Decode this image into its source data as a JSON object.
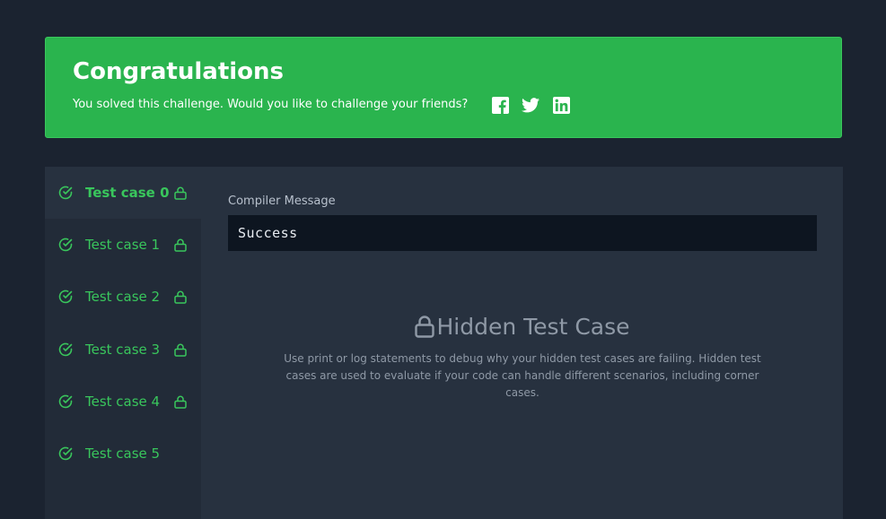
{
  "banner": {
    "title": "Congratulations",
    "message": "You solved this challenge. Would you like to challenge your friends?",
    "social": [
      "facebook-icon",
      "twitter-icon",
      "linkedin-icon"
    ],
    "color": "#2ab44e"
  },
  "test_cases": [
    {
      "label": "Test case 0",
      "passed": true,
      "locked": true,
      "active": true
    },
    {
      "label": "Test case 1",
      "passed": true,
      "locked": true,
      "active": false
    },
    {
      "label": "Test case 2",
      "passed": true,
      "locked": true,
      "active": false
    },
    {
      "label": "Test case 3",
      "passed": true,
      "locked": true,
      "active": false
    },
    {
      "label": "Test case 4",
      "passed": true,
      "locked": true,
      "active": false
    },
    {
      "label": "Test case 5",
      "passed": true,
      "locked": false,
      "active": false
    }
  ],
  "compiler": {
    "label": "Compiler Message",
    "output": "Success"
  },
  "hidden": {
    "title": "Hidden Test Case",
    "description": "Use print or log statements to debug why your hidden test cases are failing. Hidden test cases are used to evaluate if your code can handle different scenarios, including corner cases."
  },
  "colors": {
    "success": "#39c65c",
    "background": "#1b2330",
    "panel": "#27313f",
    "sidebar": "#222b38",
    "console": "#0d1520"
  }
}
